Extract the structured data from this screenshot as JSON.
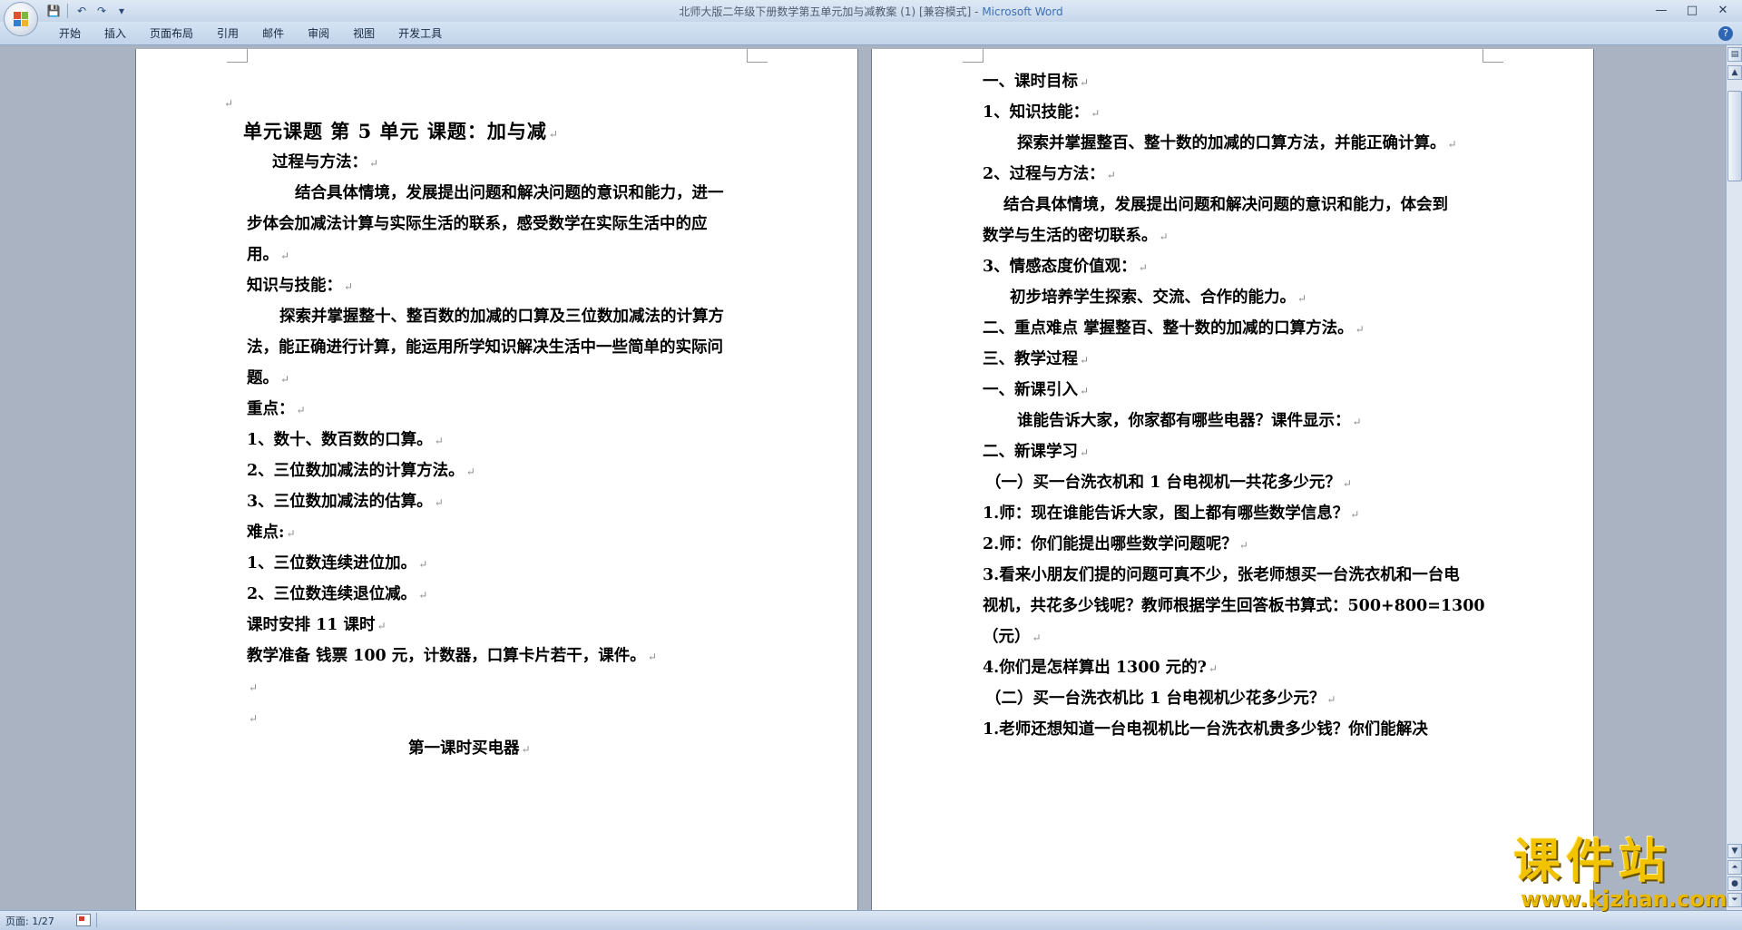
{
  "window": {
    "title": "北师大版二年级下册数学第五单元加与减教案 (1) [兼容模式] - ",
    "app_name": "Microsoft Word"
  },
  "quick_access": [
    {
      "name": "save-icon",
      "glyph": "💾"
    },
    {
      "name": "undo-icon",
      "glyph": "↶"
    },
    {
      "name": "redo-icon",
      "glyph": "↷"
    },
    {
      "name": "customize-icon",
      "glyph": "▾"
    }
  ],
  "window_controls": {
    "minimize": "—",
    "maximize": "□",
    "close": "✕"
  },
  "ribbon": {
    "tabs": [
      "开始",
      "插入",
      "页面布局",
      "引用",
      "邮件",
      "审阅",
      "视图",
      "开发工具"
    ],
    "help_glyph": "?"
  },
  "left_page": {
    "lines": [
      {
        "text": "",
        "mark": true
      },
      {
        "text": "单元课题  第   5  单元    课题：加与减",
        "mark": true
      },
      {
        "text": "过程与方法：",
        "mark": true
      },
      {
        "text": "结合具体情境，发展提出问题和解决问题的意识和能力，进一",
        "mark": false
      },
      {
        "text": "步体会加减法计算与实际生活的联系，感受数学在实际生活中的应",
        "mark": false
      },
      {
        "text": "用。",
        "mark": true
      },
      {
        "text": "知识与技能：",
        "mark": true
      },
      {
        "text": "探索并掌握整十、整百数的加减的口算及三位数加减法的计算方",
        "mark": false
      },
      {
        "text": "法，能正确进行计算，能运用所学知识解决生活中一些简单的实际问",
        "mark": false
      },
      {
        "text": "题。",
        "mark": true
      },
      {
        "text": "重点：",
        "mark": true
      },
      {
        "text": "1、数十、数百数的口算。",
        "mark": true
      },
      {
        "text": "2、三位数加减法的计算方法。",
        "mark": true
      },
      {
        "text": "3、三位数加减法的估算。",
        "mark": true
      },
      {
        "text": "难点:",
        "mark": true
      },
      {
        "text": "1、三位数连续进位加。",
        "mark": true
      },
      {
        "text": "2、三位数连续退位减。",
        "mark": true
      },
      {
        "text": "课时安排 11 课时",
        "mark": true
      },
      {
        "text": "教学准备 钱票 100 元，计数器，口算卡片若干，课件。",
        "mark": true
      },
      {
        "text": "",
        "mark": true
      },
      {
        "text": "",
        "mark": true
      },
      {
        "text": "第一课时买电器",
        "mark": true
      }
    ]
  },
  "right_page": {
    "lines": [
      {
        "text": "一、课时目标",
        "mark": true
      },
      {
        "text": "1、知识技能：",
        "mark": true
      },
      {
        "text": "探索并掌握整百、整十数的加减的口算方法，并能正确计算。",
        "mark": true
      },
      {
        "text": "2、过程与方法：",
        "mark": true
      },
      {
        "text": "结合具体情境，发展提出问题和解决问题的意识和能力，体会到",
        "mark": false
      },
      {
        "text": "数学与生活的密切联系。",
        "mark": true
      },
      {
        "text": "3、情感态度价值观：",
        "mark": true
      },
      {
        "text": "初步培养学生探索、交流、合作的能力。",
        "mark": true
      },
      {
        "text": "二、重点难点    掌握整百、整十数的加减的口算方法。",
        "mark": true
      },
      {
        "text": "三、教学过程",
        "mark": true
      },
      {
        "text": "一、新课引入",
        "mark": true
      },
      {
        "text": "谁能告诉大家，你家都有哪些电器？课件显示：",
        "mark": true
      },
      {
        "text": "二、新课学习",
        "mark": true
      },
      {
        "text": "（一）买一台洗衣机和 1 台电视机一共花多少元？",
        "mark": true
      },
      {
        "text": "1.师：现在谁能告诉大家，图上都有哪些数学信息？",
        "mark": true
      },
      {
        "text": "2.师：你们能提出哪些数学问题呢？",
        "mark": true
      },
      {
        "text": "3.看来小朋友们提的问题可真不少，张老师想买一台洗衣机和一台电",
        "mark": false
      },
      {
        "text": "视机，共花多少钱呢？教师根据学生回答板书算式：500+800=1300",
        "mark": false
      },
      {
        "text": "（元）",
        "mark": true
      },
      {
        "text": "4.你们是怎样算出 1300 元的?",
        "mark": true
      },
      {
        "text": "（二）买一台洗衣机比 1 台电视机少花多少元？",
        "mark": true
      },
      {
        "text": "1.老师还想知道一台电视机比一台洗衣机贵多少钱？你们能解决",
        "mark": false
      }
    ]
  },
  "paragraph_mark": "↵",
  "status": {
    "page": "页面: 1/27"
  },
  "watermark": {
    "cn": "课件站",
    "url": "www.kjzhan.com"
  },
  "colors": {
    "title_app": "#3e6fb3",
    "watermark": "#f2c300",
    "workspace": "#a9b3c2"
  }
}
